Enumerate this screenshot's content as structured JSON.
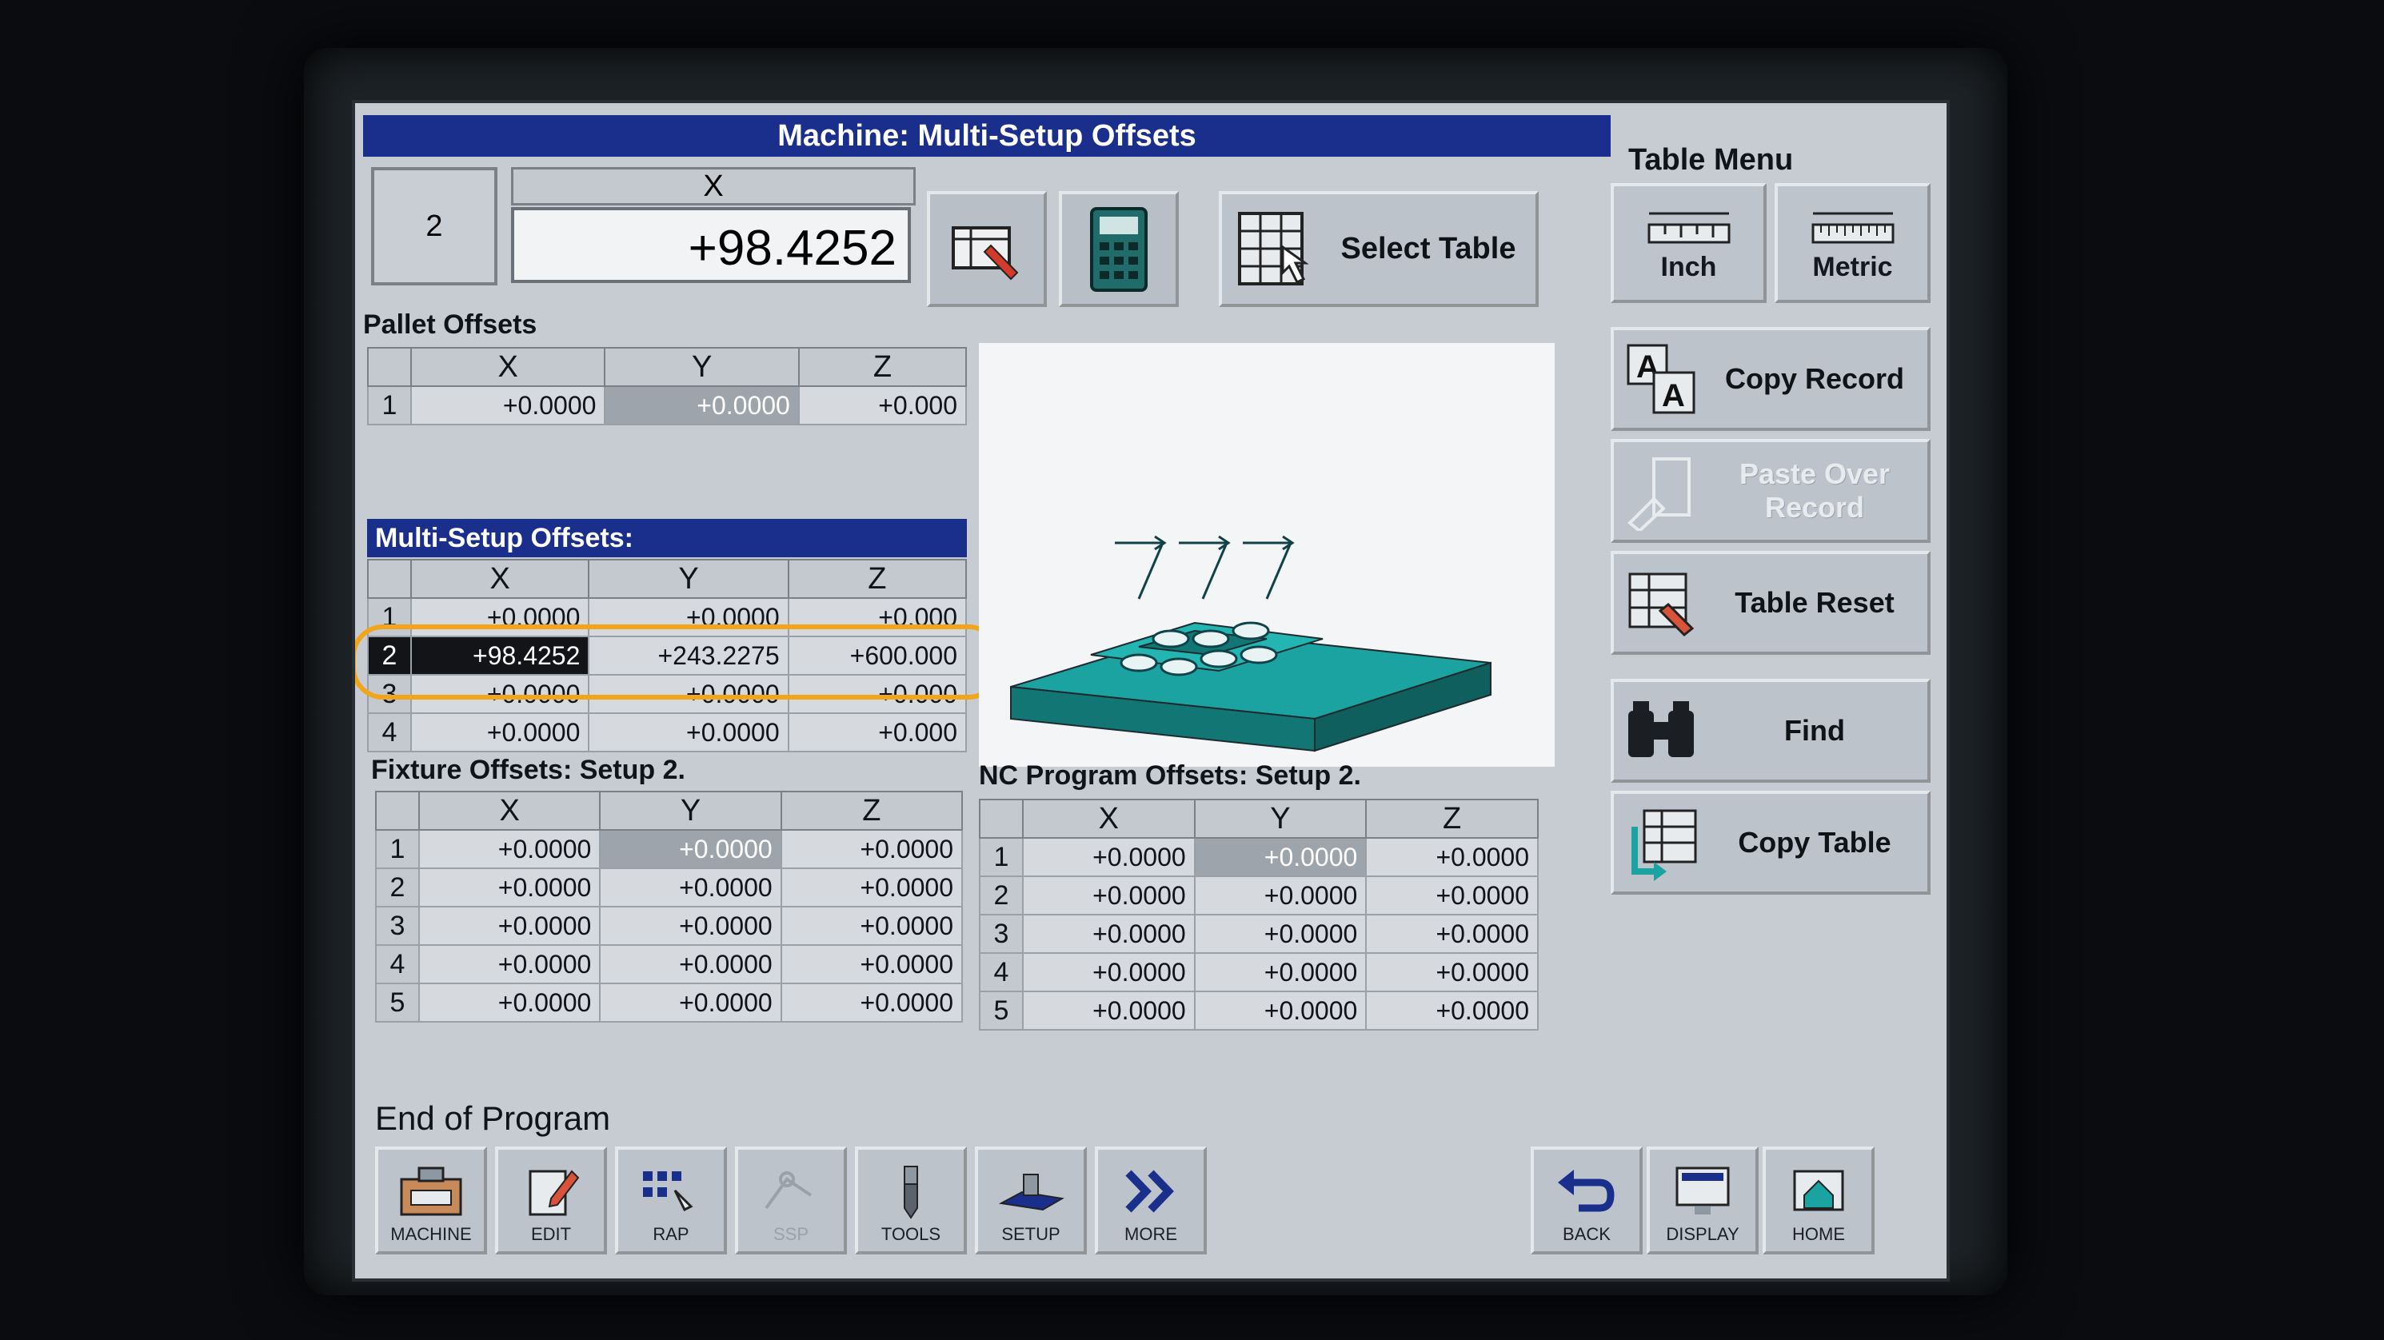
{
  "window": {
    "title": "Machine: Multi-Setup Offsets"
  },
  "table_menu": {
    "title": "Table Menu",
    "inch_label": "Inch",
    "metric_label": "Metric",
    "copy_record_label": "Copy Record",
    "paste_over_record_label": "Paste Over Record",
    "table_reset_label": "Table Reset",
    "find_label": "Find",
    "copy_table_label": "Copy Table"
  },
  "editor": {
    "row_number": "2",
    "axis": "X",
    "value": "+98.4252",
    "select_table_label": "Select Table"
  },
  "pallet_offsets": {
    "title": "Pallet Offsets",
    "columns": [
      "X",
      "Y",
      "Z"
    ],
    "rows": [
      {
        "n": "1",
        "x": "+0.0000",
        "y": "+0.0000",
        "z": "+0.000"
      }
    ]
  },
  "multi_setup_offsets": {
    "title": "Multi-Setup Offsets:",
    "columns": [
      "X",
      "Y",
      "Z"
    ],
    "rows": [
      {
        "n": "1",
        "x": "+0.0000",
        "y": "+0.0000",
        "z": "+0.000"
      },
      {
        "n": "2",
        "x": "+98.4252",
        "y": "+243.2275",
        "z": "+600.000"
      },
      {
        "n": "3",
        "x": "+0.0000",
        "y": "+0.0000",
        "z": "+0.000"
      },
      {
        "n": "4",
        "x": "+0.0000",
        "y": "+0.0000",
        "z": "+0.000"
      }
    ]
  },
  "fixture_offsets": {
    "title": "Fixture Offsets: Setup  2.",
    "columns": [
      "X",
      "Y",
      "Z"
    ],
    "rows": [
      {
        "n": "1",
        "x": "+0.0000",
        "y": "+0.0000",
        "z": "+0.0000"
      },
      {
        "n": "2",
        "x": "+0.0000",
        "y": "+0.0000",
        "z": "+0.0000"
      },
      {
        "n": "3",
        "x": "+0.0000",
        "y": "+0.0000",
        "z": "+0.0000"
      },
      {
        "n": "4",
        "x": "+0.0000",
        "y": "+0.0000",
        "z": "+0.0000"
      },
      {
        "n": "5",
        "x": "+0.0000",
        "y": "+0.0000",
        "z": "+0.0000"
      }
    ]
  },
  "nc_program_offsets": {
    "title": "NC Program Offsets: Setup  2.",
    "columns": [
      "X",
      "Y",
      "Z"
    ],
    "rows": [
      {
        "n": "1",
        "x": "+0.0000",
        "y": "+0.0000",
        "z": "+0.0000"
      },
      {
        "n": "2",
        "x": "+0.0000",
        "y": "+0.0000",
        "z": "+0.0000"
      },
      {
        "n": "3",
        "x": "+0.0000",
        "y": "+0.0000",
        "z": "+0.0000"
      },
      {
        "n": "4",
        "x": "+0.0000",
        "y": "+0.0000",
        "z": "+0.0000"
      },
      {
        "n": "5",
        "x": "+0.0000",
        "y": "+0.0000",
        "z": "+0.0000"
      }
    ]
  },
  "status": {
    "text": "End of Program"
  },
  "bottom_bar": {
    "machine": "MACHINE",
    "edit": "EDIT",
    "rap": "RAP",
    "ssp": "SSP",
    "tools": "TOOLS",
    "setup": "SETUP",
    "more": "MORE",
    "back": "BACK",
    "display": "DISPLAY",
    "home": "HOME"
  },
  "colors": {
    "title_bar": "#1a2f8c",
    "screen_bg": "#c7ccd3",
    "highlight_ring": "#f2a51a",
    "fixture_teal": "#1aa3a0"
  }
}
